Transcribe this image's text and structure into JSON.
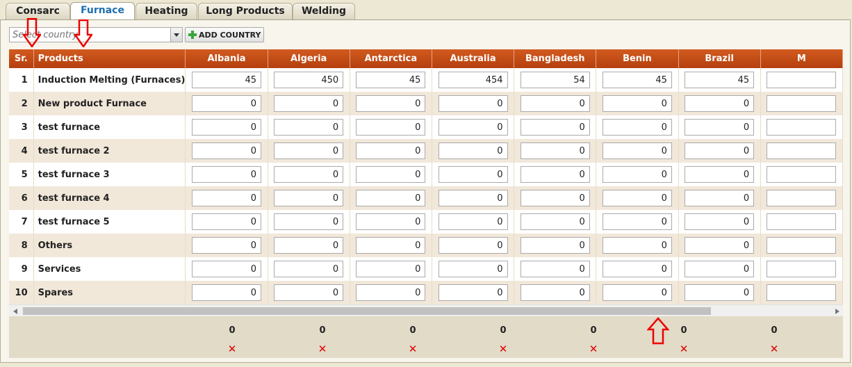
{
  "tabs": [
    {
      "label": "Consarc",
      "active": false
    },
    {
      "label": "Furnace",
      "active": true
    },
    {
      "label": "Heating",
      "active": false
    },
    {
      "label": "Long Products",
      "active": false
    },
    {
      "label": "Welding",
      "active": false
    }
  ],
  "toolbar": {
    "country_placeholder": "Select country",
    "add_country_label": "ADD COUNTRY"
  },
  "grid": {
    "columns": {
      "sr": "Sr.",
      "products": "Products",
      "countries": [
        "Albania",
        "Algeria",
        "Antarctica",
        "Australia",
        "Bangladesh",
        "Benin",
        "Brazil",
        "M"
      ]
    },
    "rows": [
      {
        "sr": "1",
        "product": "Induction Melting (Furnaces)",
        "values": [
          "45",
          "450",
          "45",
          "454",
          "54",
          "45",
          "45",
          ""
        ]
      },
      {
        "sr": "2",
        "product": "New product Furnace",
        "values": [
          "0",
          "0",
          "0",
          "0",
          "0",
          "0",
          "0",
          ""
        ]
      },
      {
        "sr": "3",
        "product": "test furnace",
        "values": [
          "0",
          "0",
          "0",
          "0",
          "0",
          "0",
          "0",
          ""
        ]
      },
      {
        "sr": "4",
        "product": "test furnace 2",
        "values": [
          "0",
          "0",
          "0",
          "0",
          "0",
          "0",
          "0",
          ""
        ]
      },
      {
        "sr": "5",
        "product": "test furnace 3",
        "values": [
          "0",
          "0",
          "0",
          "0",
          "0",
          "0",
          "0",
          ""
        ]
      },
      {
        "sr": "6",
        "product": "test furnace 4",
        "values": [
          "0",
          "0",
          "0",
          "0",
          "0",
          "0",
          "0",
          ""
        ]
      },
      {
        "sr": "7",
        "product": "test furnace 5",
        "values": [
          "0",
          "0",
          "0",
          "0",
          "0",
          "0",
          "0",
          ""
        ]
      },
      {
        "sr": "8",
        "product": "Others",
        "values": [
          "0",
          "0",
          "0",
          "0",
          "0",
          "0",
          "0",
          ""
        ]
      },
      {
        "sr": "9",
        "product": "Services",
        "values": [
          "0",
          "0",
          "0",
          "0",
          "0",
          "0",
          "0",
          ""
        ]
      },
      {
        "sr": "10",
        "product": "Spares",
        "values": [
          "0",
          "0",
          "0",
          "0",
          "0",
          "0",
          "0",
          ""
        ]
      }
    ],
    "totals": [
      "0",
      "0",
      "0",
      "0",
      "0",
      "0",
      "0"
    ],
    "delete_glyph": "✕"
  },
  "colors": {
    "header_orange": "#c24c14",
    "row_alt": "#f1e8da",
    "delete_red": "#e00000",
    "annotation_red": "#ee0000",
    "active_tab_text": "#1d6fb0"
  },
  "icons": {
    "dropdown": "triangle-down-icon",
    "add": "plus-icon",
    "delete": "red-x-icon",
    "annotation": "red-outline-arrow"
  }
}
